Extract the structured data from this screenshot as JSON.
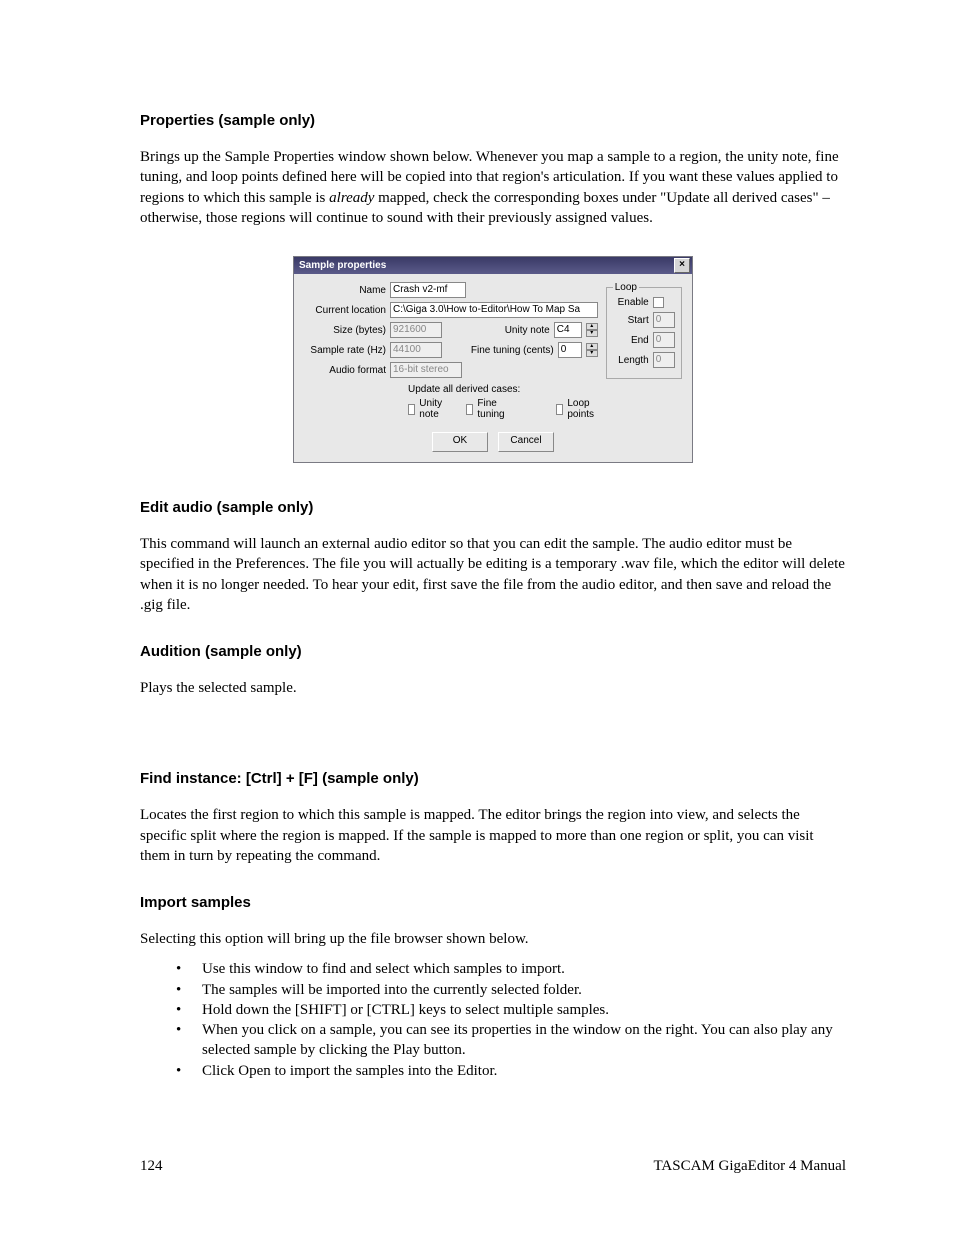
{
  "sections": {
    "properties": {
      "heading": "Properties (sample only)",
      "body_pre": "Brings up the Sample Properties window shown below.  Whenever you map a sample to a region, the unity note, fine tuning, and loop points defined here will be copied into that region's articulation.  If you want these values applied to regions to which this sample is ",
      "body_em": "already",
      "body_post": " mapped, check the corresponding boxes under \"Update all derived cases\" – otherwise, those regions will continue to sound with their previously assigned values."
    },
    "edit_audio": {
      "heading": "Edit audio (sample only)",
      "body": "This command will launch an external audio editor so that you can edit the sample.  The audio editor must be specified in the Preferences.  The file you will actually be editing is a temporary .wav file, which the editor will delete when it is no longer needed.  To hear your edit, first save the file from the audio editor, and then save and reload the .gig file."
    },
    "audition": {
      "heading": "Audition (sample only)",
      "body": "Plays the selected sample."
    },
    "find_instance": {
      "heading": "Find instance: [Ctrl] + [F] (sample only)",
      "body": "Locates the first region to which this sample is mapped.  The editor brings the region into view, and selects the specific split where the region is mapped.  If the sample is mapped to more than one region or split, you can visit them in turn by repeating the command."
    },
    "import": {
      "heading": "Import samples",
      "body": "Selecting this option will bring up the file browser shown below.",
      "bullets": [
        "Use this window to find and select which samples to import.",
        "The samples will be imported into the currently selected folder.",
        "Hold down the [SHIFT] or [CTRL] keys to select multiple samples.",
        "When you click on a sample, you can see its properties in the window on the right. You can also play any selected sample by clicking the Play button.",
        "Click Open to import the samples into the Editor."
      ]
    }
  },
  "dialog": {
    "title": "Sample properties",
    "labels": {
      "name": "Name",
      "location": "Current location",
      "size": "Size (bytes)",
      "sample_rate": "Sample rate (Hz)",
      "audio_format": "Audio format",
      "unity_note": "Unity note",
      "fine_tuning": "Fine tuning (cents)",
      "update_all": "Update all derived cases:",
      "chk_unity": "Unity note",
      "chk_fine": "Fine tuning",
      "chk_loop": "Loop points"
    },
    "values": {
      "name": "Crash v2-mf",
      "location": "C:\\Giga 3.0\\How to-Editor\\How To Map Sa",
      "size": "921600",
      "sample_rate": "44100",
      "audio_format": "16-bit stereo",
      "unity_note": "C4",
      "fine_tuning": "0"
    },
    "loop": {
      "legend": "Loop",
      "enable_label": "Enable",
      "start_label": "Start",
      "end_label": "End",
      "length_label": "Length",
      "start": "0",
      "end": "0",
      "length": "0"
    },
    "buttons": {
      "ok": "OK",
      "cancel": "Cancel"
    }
  },
  "footer": {
    "page": "124",
    "doc": "TASCAM GigaEditor 4 Manual"
  }
}
